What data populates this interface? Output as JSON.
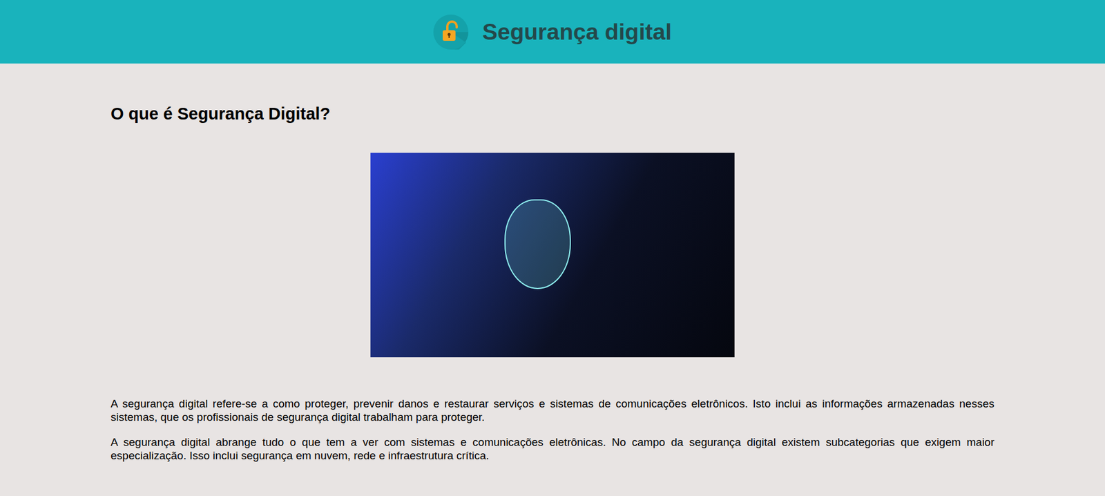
{
  "header": {
    "title": "Segurança digital"
  },
  "article": {
    "heading": "O que é Segurança Digital?",
    "paragraphs": [
      "A segurança digital refere-se a como proteger, prevenir danos e restaurar serviços e sistemas de comunicações eletrônicos. Isto inclui as informações armazenadas nesses sistemas, que os profissionais de segurança digital trabalham para proteger.",
      "A segurança digital abrange tudo o que tem a ver com sistemas e comunicações eletrônicas. No campo da segurança digital existem subcategorias que exigem maior especialização. Isso inclui segurança em nuvem, rede e infraestrutura crítica."
    ]
  }
}
